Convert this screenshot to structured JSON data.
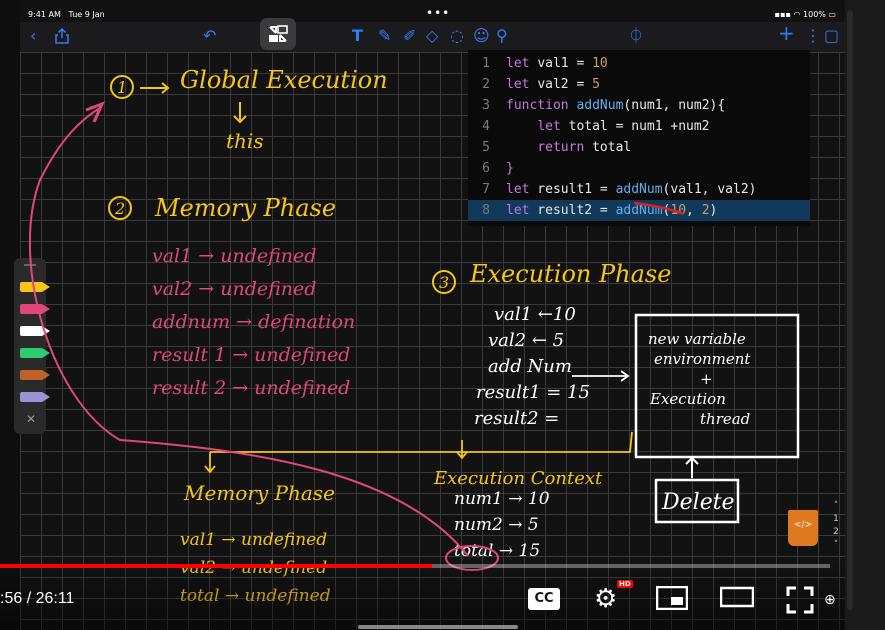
{
  "status": {
    "time": "9:41 AM",
    "date": "Tue 9 Jan",
    "battery": "100%"
  },
  "code": {
    "lines": [
      {
        "n": "1",
        "parts": [
          [
            "kw",
            "let"
          ],
          [
            "",
            "val1 = "
          ],
          [
            "num",
            "10"
          ]
        ]
      },
      {
        "n": "2",
        "parts": [
          [
            "kw",
            "let"
          ],
          [
            "",
            "val2 = "
          ],
          [
            "num",
            "5"
          ]
        ]
      },
      {
        "n": "3",
        "parts": [
          [
            "kw",
            "function"
          ],
          [
            "",
            " "
          ],
          [
            "fn",
            "addNum"
          ],
          [
            "",
            "(num1, num2){"
          ]
        ]
      },
      {
        "n": "4",
        "parts": [
          [
            "",
            "    "
          ],
          [
            "kw",
            "let"
          ],
          [
            "",
            " total = num1 +num2"
          ]
        ]
      },
      {
        "n": "5",
        "parts": [
          [
            "",
            "    "
          ],
          [
            "kw",
            "return"
          ],
          [
            "",
            " total"
          ]
        ]
      },
      {
        "n": "6",
        "parts": [
          [
            "kw",
            "}"
          ]
        ]
      },
      {
        "n": "7",
        "parts": [
          [
            "kw",
            "let"
          ],
          [
            "",
            " result1 = "
          ],
          [
            "fn",
            "addNum"
          ],
          [
            "",
            "(val1, val2)"
          ]
        ]
      },
      {
        "n": "8",
        "parts": [
          [
            "kw",
            "let"
          ],
          [
            "",
            " result2 = "
          ],
          [
            "fn",
            "addNum"
          ],
          [
            "",
            "("
          ],
          [
            "num",
            "10"
          ],
          [
            "",
            ", "
          ],
          [
            "num",
            "2"
          ],
          [
            "",
            ")"
          ]
        ]
      }
    ],
    "highlighted_line": "8"
  },
  "notes": {
    "step1": "1",
    "global": "Global Execution",
    "this": "this",
    "step2": "2",
    "memory_phase": "Memory Phase",
    "memory_items": [
      "val1 → undefined",
      "val2 → undefined",
      "addnum → defination",
      "result 1 → undefined",
      "result 2 → undefined"
    ],
    "step3": "3",
    "execution_phase": "Execution Phase",
    "exec_items": [
      "val1 ←10",
      "val2 ← 5",
      "add Num",
      "result1 = 15",
      "result2 ="
    ],
    "box_lines": [
      "new variable",
      "environment",
      "+",
      "Execution",
      "thread"
    ],
    "delete": "Delete",
    "memory_phase_2": "Memory Phase",
    "memory_items_2": [
      "val1 → undefined",
      "val2 → undefined",
      "total → undefined"
    ],
    "exec_context": "Execution Context",
    "context_items": [
      "num1 → 10",
      "num2 → 5",
      "total → 15"
    ]
  },
  "player": {
    "time": ":56 / 26:11",
    "progress": 0.52,
    "cc_label": "CC",
    "hd_badge": "HD"
  },
  "page_numbers": [
    "1",
    "2"
  ],
  "colors": {
    "yellow": "#f5c518",
    "pink": "#e0487a",
    "white": "#ffffff",
    "accent": "#2f7cf6",
    "red": "#ff0000"
  }
}
